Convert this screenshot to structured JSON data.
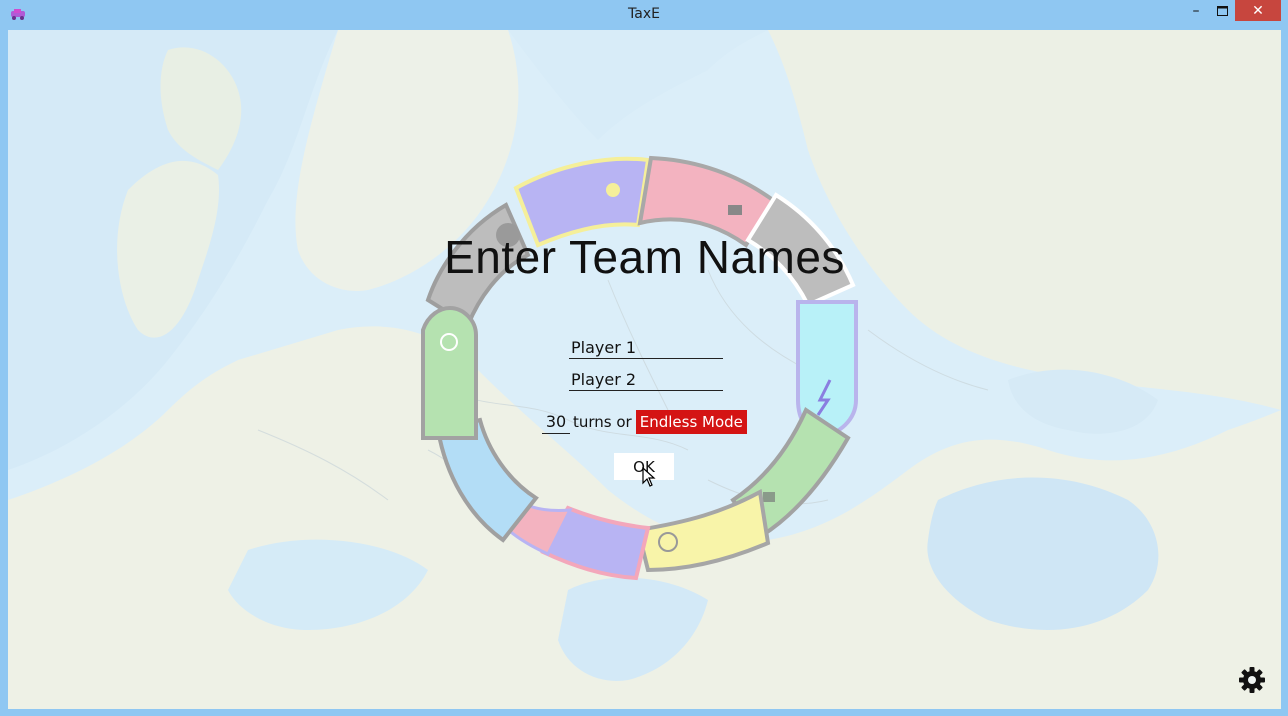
{
  "window": {
    "title": "TaxE",
    "minimize_glyph": "–",
    "close_glyph": "✕",
    "maximize_icon": "maximize-icon",
    "app_icon": "taxe-app-icon"
  },
  "screen": {
    "heading": "Enter Team Names",
    "player1_value": "Player 1",
    "player2_value": "Player 2",
    "turns_value": "30",
    "turns_label": "turns or",
    "endless_label": "Endless Mode",
    "ok_label": "OK",
    "settings_icon": "gear-icon"
  },
  "colors": {
    "titlebar": "#8fc7f2",
    "endless_bg": "#d41414",
    "close_bg": "#c7463e"
  }
}
